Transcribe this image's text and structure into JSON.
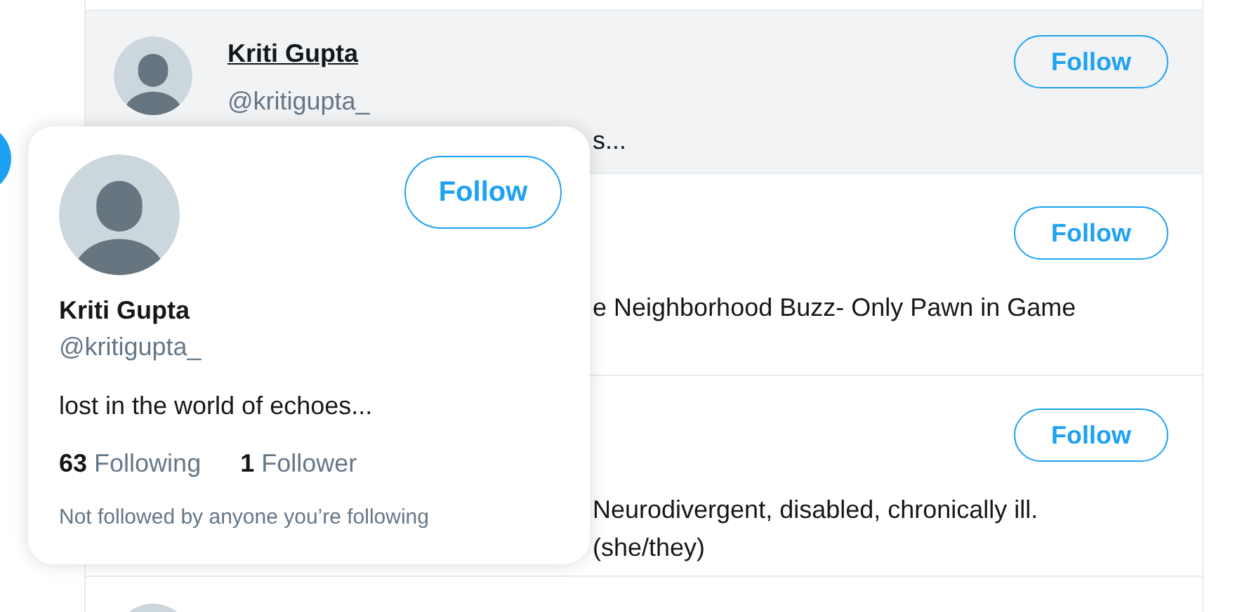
{
  "rows": [
    {
      "name": "Kriti Gupta",
      "handle": "@kritigupta_",
      "bio": "s...",
      "highlighted": true,
      "button": "Follow"
    },
    {
      "bio": "e Neighborhood Buzz- Only Pawn in Game",
      "highlighted": false,
      "button": "Follow"
    },
    {
      "bio": "Neurodivergent, disabled, chronically ill. (she/they)",
      "highlighted": false,
      "button": "Follow"
    }
  ],
  "hover_card": {
    "name": "Kriti Gupta",
    "handle": "@kritigupta_",
    "bio": "lost in the world of echoes...",
    "following_count": "63",
    "following_label": "Following",
    "followers_count": "1",
    "followers_label": "Follower",
    "note": "Not followed by anyone you’re following",
    "button": "Follow"
  }
}
